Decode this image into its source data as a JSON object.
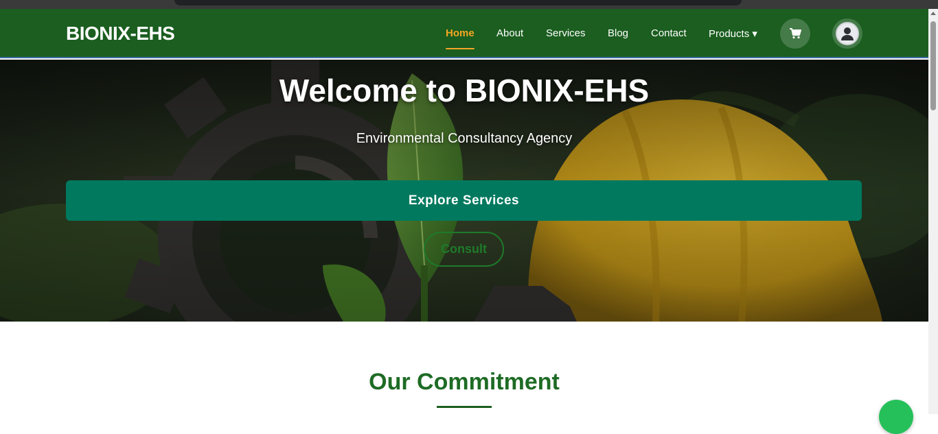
{
  "brand": {
    "name": "BIONIX-EHS"
  },
  "nav": {
    "items": [
      {
        "label": "Home",
        "active": true
      },
      {
        "label": "About"
      },
      {
        "label": "Services"
      },
      {
        "label": "Blog"
      },
      {
        "label": "Contact"
      },
      {
        "label": "Products ▾"
      }
    ],
    "cart_icon": "cart-icon",
    "user_icon": "user-avatar-icon"
  },
  "hero": {
    "title": "Welcome to BIONIX-EHS",
    "subtitle": "Environmental Consultancy Agency",
    "primary_button": "Explore Services",
    "secondary_button": "Consult"
  },
  "section": {
    "title": "Our Commitment"
  },
  "colors": {
    "nav_bg": "#1b5e20",
    "accent": "#f5a623",
    "primary_button": "#00795f",
    "section_title": "#1e6b25",
    "chat_fab": "#25c05a"
  }
}
